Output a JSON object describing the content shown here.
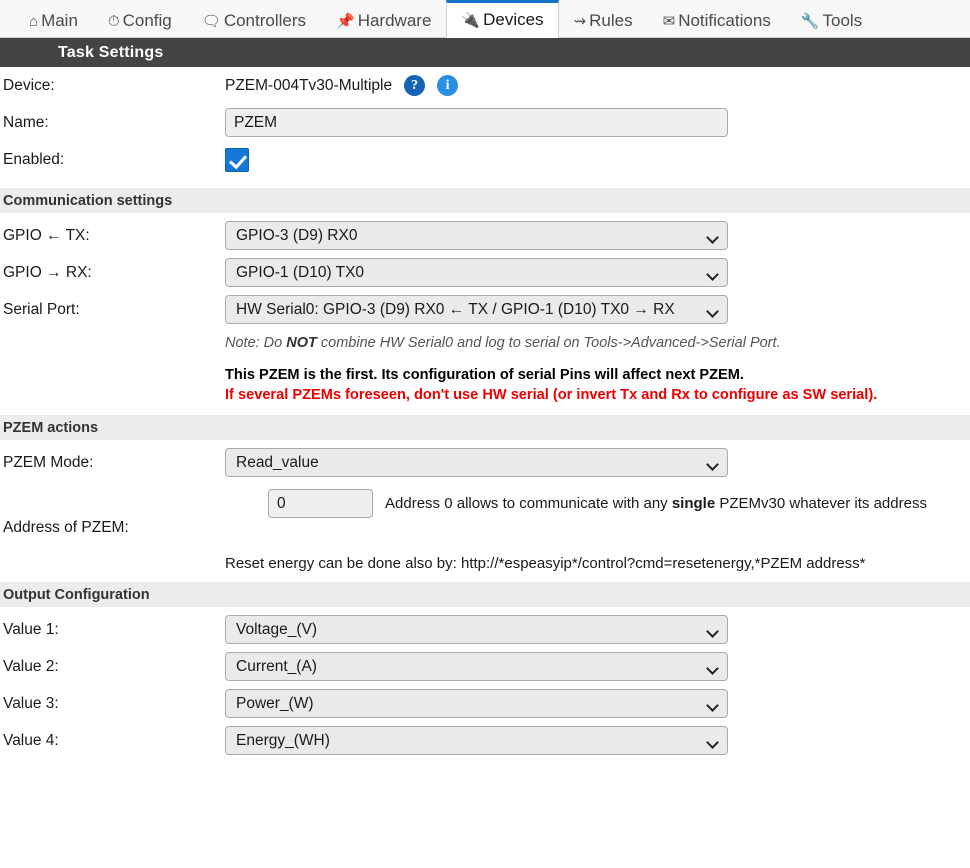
{
  "nav": {
    "tabs": [
      {
        "label": "Main",
        "icon": "home-icon",
        "glyph": "⌂",
        "active": false
      },
      {
        "label": "Config",
        "icon": "gear-icon",
        "glyph": "⏱",
        "active": false
      },
      {
        "label": "Controllers",
        "icon": "speech-bubble-icon",
        "glyph": "💬",
        "active": false
      },
      {
        "label": "Hardware",
        "icon": "pushpin-icon",
        "glyph": "📌",
        "active": false
      },
      {
        "label": "Devices",
        "icon": "plug-icon",
        "glyph": "🔌",
        "active": true
      },
      {
        "label": "Rules",
        "icon": "arrow-right-icon",
        "glyph": "↝",
        "active": false
      },
      {
        "label": "Notifications",
        "icon": "envelope-icon",
        "glyph": "✉",
        "active": false
      },
      {
        "label": "Tools",
        "icon": "wrench-icon",
        "glyph": "🔧",
        "active": false
      }
    ]
  },
  "titlebar": {
    "title": "Task Settings"
  },
  "device": {
    "label": "Device:",
    "name": "PZEM-004Tv30-Multiple",
    "help_badge": "?",
    "info_badge": "i"
  },
  "name": {
    "label": "Name:",
    "value": "PZEM",
    "placeholder": ""
  },
  "enabled": {
    "label": "Enabled:",
    "checked": true
  },
  "communication": {
    "section_title": "Communication settings",
    "gpio_tx": {
      "label": "GPIO ← TX:",
      "value": "GPIO-3 (D9) RX0"
    },
    "gpio_rx": {
      "label": "GPIO → RX:",
      "value": "GPIO-1 (D10) TX0"
    },
    "serial_port": {
      "label": "Serial Port:",
      "value": "HW Serial0: GPIO-3 (D9) RX0 ← TX / GPIO-1 (D10) TX0 → RX"
    },
    "note_prefix": "Note: Do ",
    "note_bold": "NOT",
    "note_suffix": " combine HW Serial0 and log to serial on Tools->Advanced->Serial Port.",
    "warn_black": "This PZEM is the first. Its configuration of serial Pins will affect next PZEM.",
    "warn_red": "If several PZEMs foreseen, don't use HW serial (or invert Tx and Rx to configure as SW serial)."
  },
  "pzem_actions": {
    "section_title": "PZEM actions",
    "mode": {
      "label": "PZEM Mode:",
      "value": "Read_value"
    },
    "address": {
      "label": "Address of PZEM:",
      "value": "0",
      "hint_prefix": "Address 0 allows to communicate with any ",
      "hint_bold": "single",
      "hint_suffix": " PZEMv30 whatever its address",
      "reset_line": "Reset energy can be done also by: http://*espeasyip*/control?cmd=resetenergy,*PZEM address*"
    }
  },
  "output": {
    "section_title": "Output Configuration",
    "values": [
      {
        "label": "Value 1:",
        "value": "Voltage_(V)"
      },
      {
        "label": "Value 2:",
        "value": "Current_(A)"
      },
      {
        "label": "Value 3:",
        "value": "Power_(W)"
      },
      {
        "label": "Value 4:",
        "value": "Energy_(WH)"
      }
    ]
  },
  "colors": {
    "active_tab_accent": "#1273c6",
    "titlebar_bg": "#444444",
    "section_bg": "#ececec",
    "checkbox_blue": "#1478d4",
    "warning_red": "#ee0000",
    "help_badge_blue": "#1763b5",
    "info_badge_blue": "#2a8fe0"
  }
}
